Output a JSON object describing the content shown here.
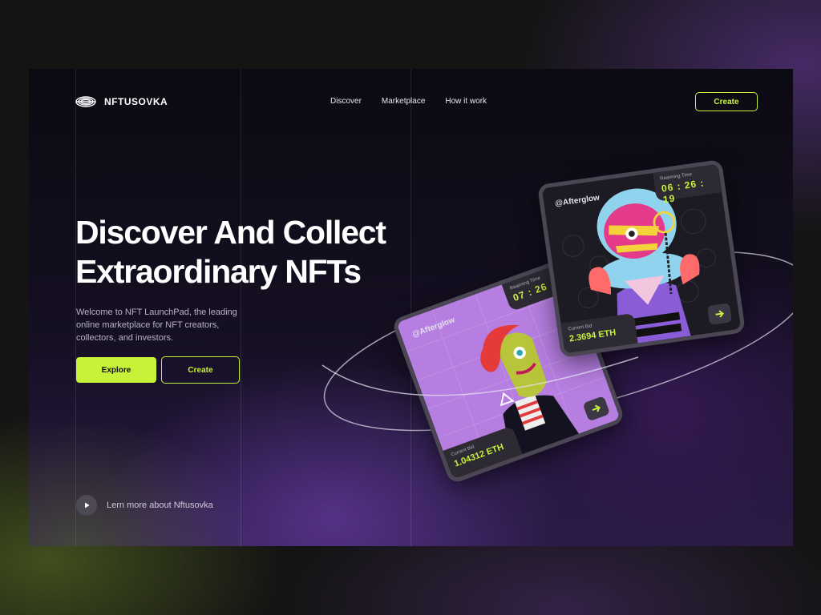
{
  "brand": {
    "name": "NFTUSOVKA"
  },
  "nav": {
    "links": [
      "Discover",
      "Marketplace",
      "How it work"
    ],
    "create_label": "Create"
  },
  "hero": {
    "title_line1": "Discover And Collect",
    "title_line2": "Extraordinary NFTs",
    "description": "Welcome to NFT LaunchPad, the leading online marketplace for NFT creators, collectors, and investors.",
    "explore_label": "Explore",
    "create_label": "Create"
  },
  "learn_more": {
    "label": "Lern more about Nftusovka",
    "icon": "play-icon"
  },
  "cards": {
    "front": {
      "handle": "@Afterglow",
      "timer_label": "Reaiming Time",
      "timer_value": "06 : 26 : 19",
      "bid_label": "Current Bid",
      "bid_value": "2.3694 ETH",
      "icon": "arrow-right-icon"
    },
    "back": {
      "handle": "@Afterglow",
      "timer_label": "Reaiming Time",
      "timer_value": "07 : 26",
      "bid_label": "Current Bid",
      "bid_value": "1.04312 ETH",
      "icon": "arrow-right-icon"
    }
  },
  "colors": {
    "accent": "#c7f23a",
    "background": "#141414",
    "card": "#3a3644"
  }
}
